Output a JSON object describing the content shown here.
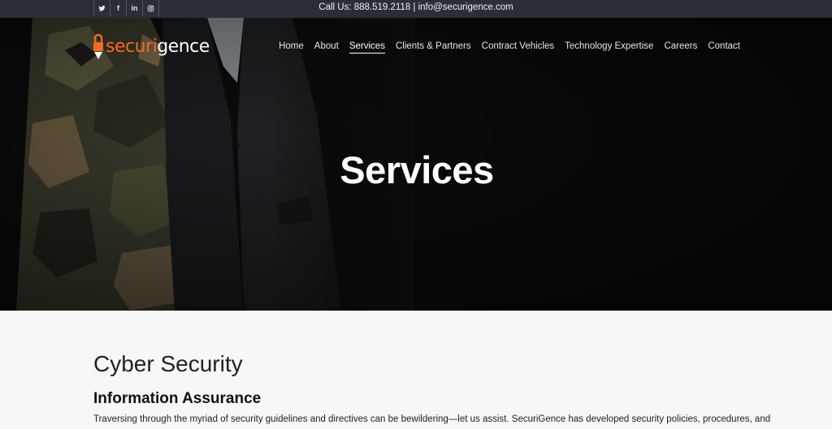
{
  "topbar": {
    "social": [
      {
        "icon": "twitter-icon"
      },
      {
        "icon": "facebook-icon",
        "glyph": "f"
      },
      {
        "icon": "linkedin-icon",
        "glyph": "in"
      },
      {
        "icon": "instagram-icon"
      }
    ],
    "contact_text": "Call Us: 888.519.2118 | info@securigence.com"
  },
  "logo": {
    "part1": "securi",
    "part2": "gence"
  },
  "nav": {
    "items": [
      "Home",
      "About",
      "Services",
      "Clients & Partners",
      "Contract Vehicles",
      "Technology Expertise",
      "Careers",
      "Contact"
    ],
    "active": "Services"
  },
  "hero": {
    "title": "Services"
  },
  "content": {
    "heading": "Cyber Security",
    "subheading": "Information Assurance",
    "paragraph": "Traversing through the myriad of security guidelines and directives can be bewildering—let us assist. SecuriGence has developed security policies, procedures, and"
  },
  "colors": {
    "brand_orange": "#f26a23",
    "topbar_bg": "#2a2f36",
    "hero_bg": "#0b0b0b"
  }
}
